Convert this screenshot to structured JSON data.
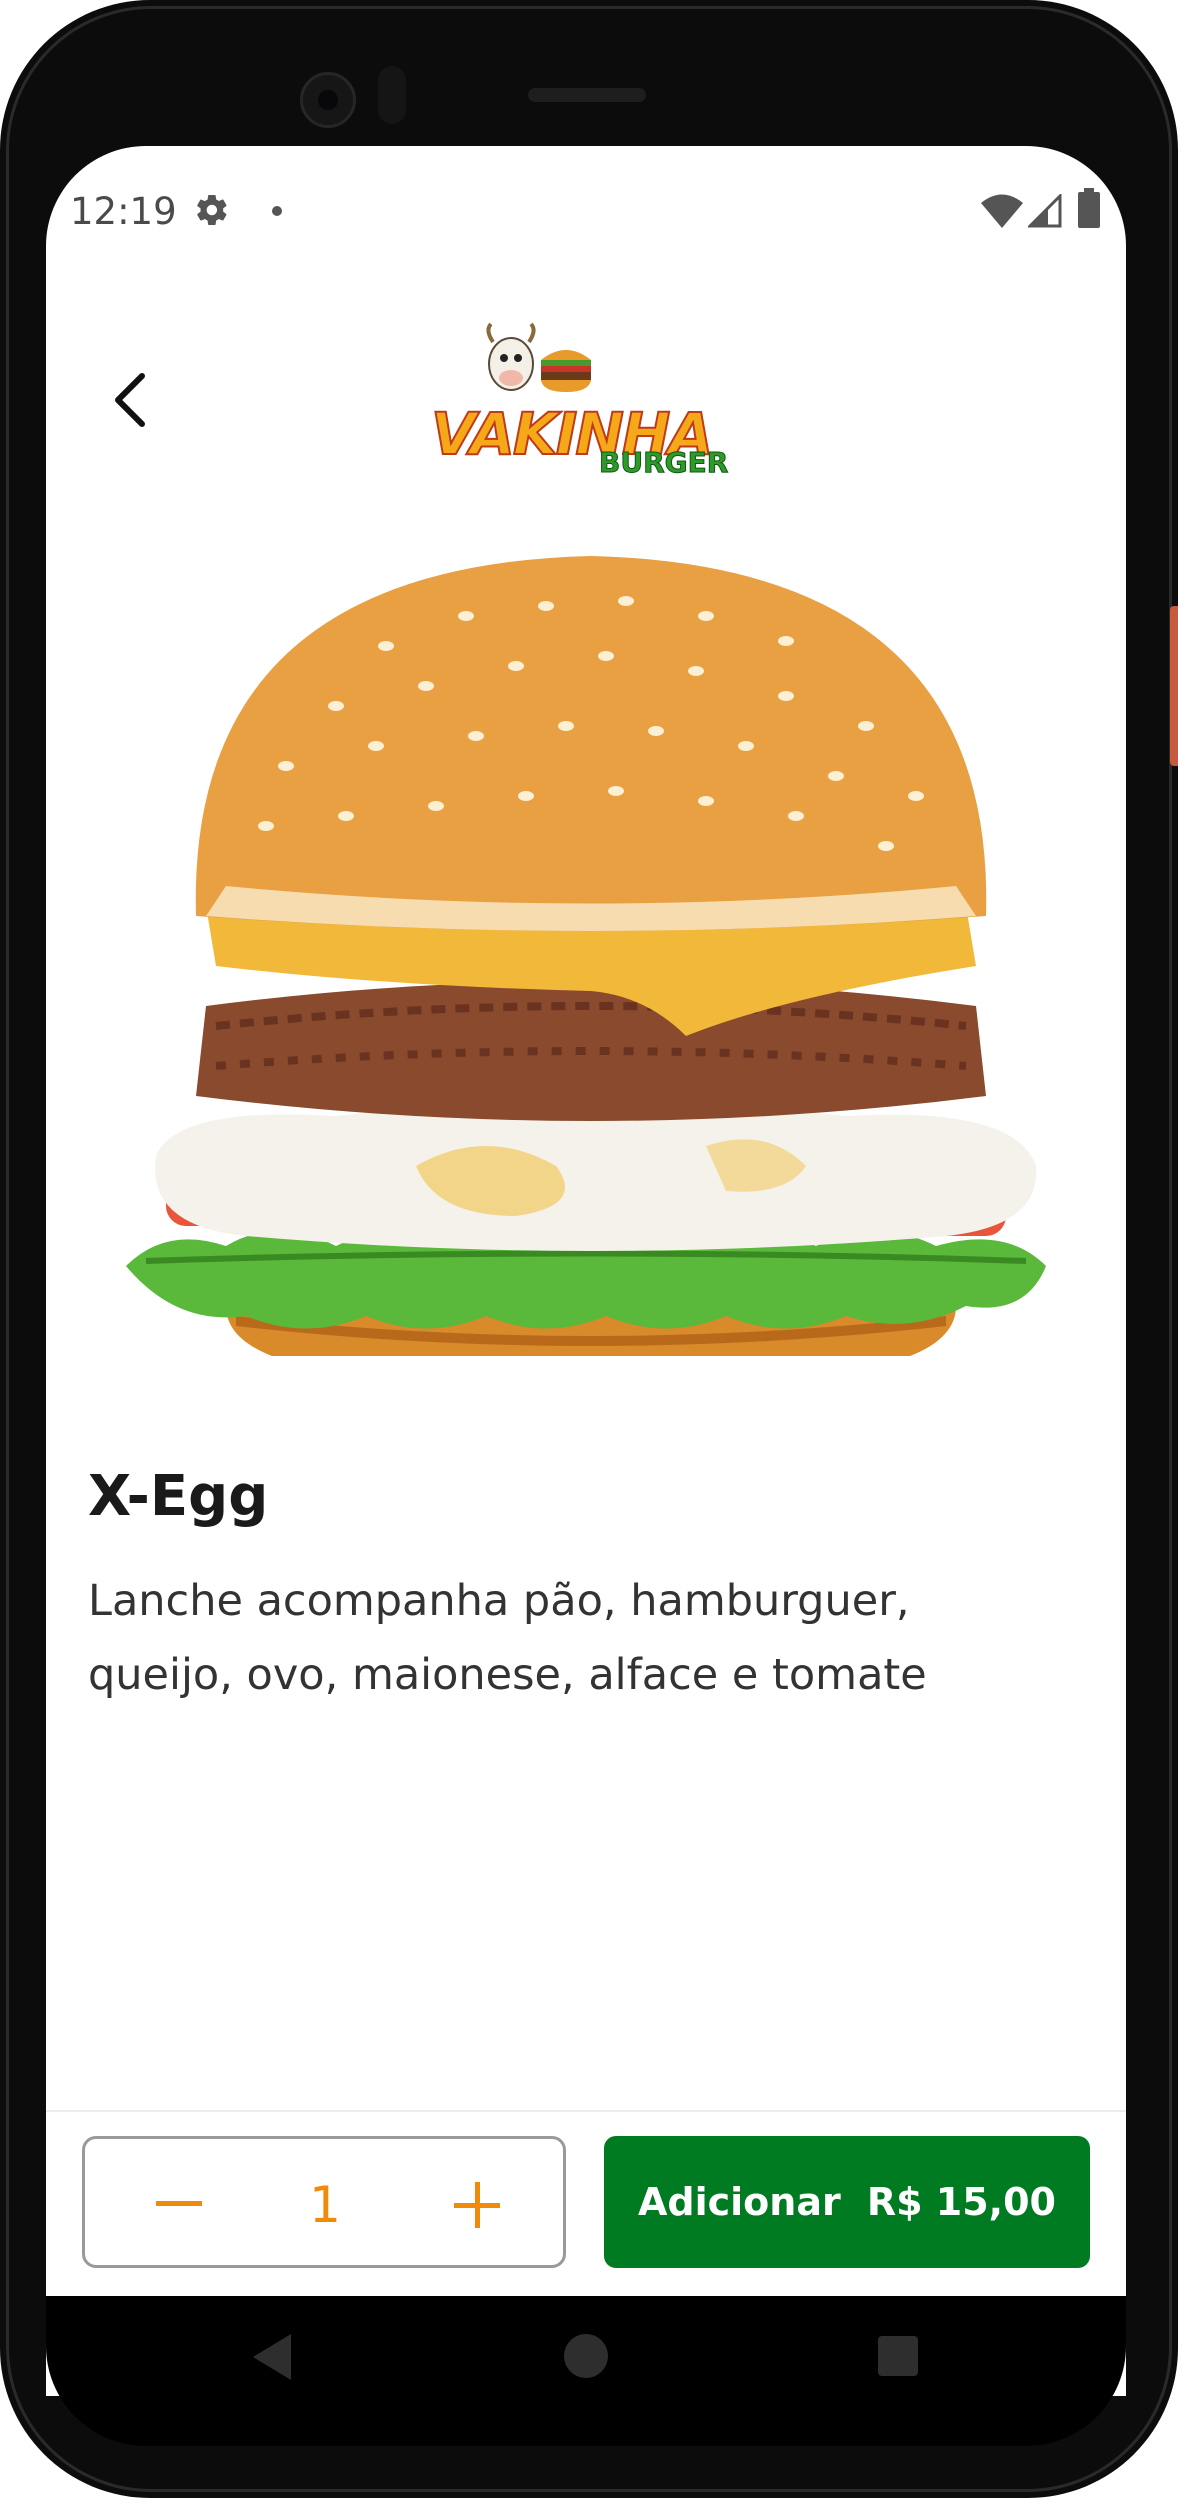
{
  "status_bar": {
    "time": "12:19",
    "icons": [
      "gear-icon",
      "notification-dot-icon",
      "wifi-icon",
      "signal-icon",
      "battery-icon"
    ]
  },
  "header": {
    "back_icon": "chevron-left-icon",
    "logo": {
      "brand": "VAKINHA",
      "sub": "BURGER"
    }
  },
  "product": {
    "name": "X-Egg",
    "description": "Lanche acompanha pão, hamburguer, queijo, ovo, maionese, alface e tomate"
  },
  "footer": {
    "quantity": "1",
    "minus_icon": "minus-icon",
    "plus_icon": "plus-icon",
    "add_label": "Adicionar",
    "price": "R$ 15,00"
  },
  "nav": {
    "icons": [
      "triangle-back-icon",
      "circle-home-icon",
      "square-recents-icon"
    ]
  },
  "colors": {
    "accent_orange": "#f08a0b",
    "primary_green": "#007b22"
  }
}
